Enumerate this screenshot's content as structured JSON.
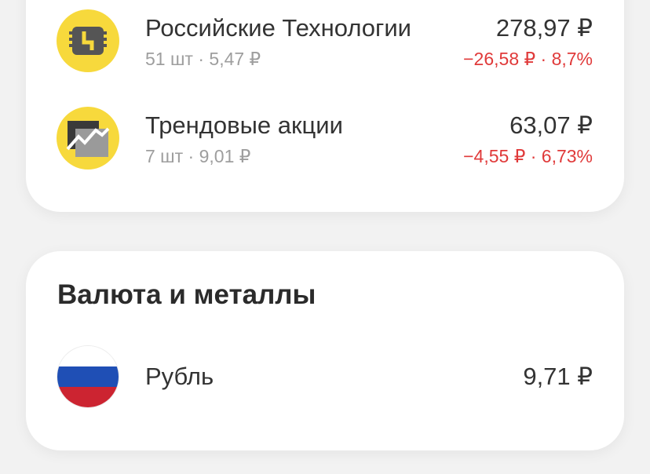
{
  "funds": [
    {
      "name": "Российские Технологии",
      "meta": "51 шт · 5,47 ₽",
      "price": "278,97 ₽",
      "change": "−26,58 ₽ · 8,7%",
      "icon": "chip-icon"
    },
    {
      "name": "Трендовые акции",
      "meta": "7 шт · 9,01 ₽",
      "price": "63,07 ₽",
      "change": "−4,55 ₽ · 6,73%",
      "icon": "trend-chart-icon"
    }
  ],
  "currency_section": {
    "title": "Валюта и металлы",
    "items": [
      {
        "name": "Рубль",
        "value": "9,71 ₽",
        "icon": "russia-flag-icon"
      }
    ]
  },
  "colors": {
    "background": "#f2f2f2",
    "card": "#ffffff",
    "logo_yellow": "#f7d93c",
    "negative": "#e03a3a",
    "muted": "#9e9e9e",
    "flag_white": "#ffffff",
    "flag_blue": "#1f4fb5",
    "flag_red": "#cc2431"
  }
}
